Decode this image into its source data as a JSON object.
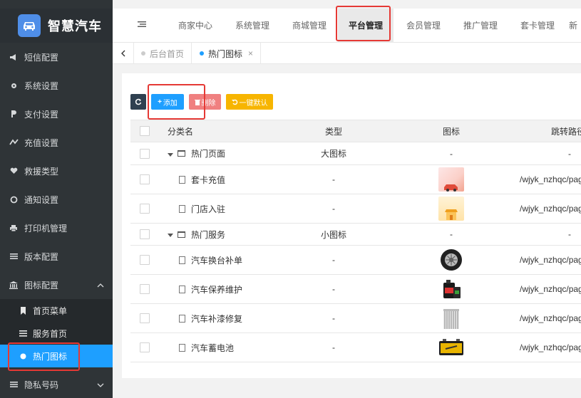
{
  "app": {
    "title": "智慧汽车"
  },
  "sidebar": {
    "items": [
      {
        "label": "短信配置",
        "icon": "megaphone-icon"
      },
      {
        "label": "系统设置",
        "icon": "gear-icon"
      },
      {
        "label": "支付设置",
        "icon": "payment-icon"
      },
      {
        "label": "充值设置",
        "icon": "recharge-icon"
      },
      {
        "label": "救援类型",
        "icon": "heart-icon"
      },
      {
        "label": "通知设置",
        "icon": "circle-icon"
      },
      {
        "label": "打印机管理",
        "icon": "printer-icon"
      },
      {
        "label": "版本配置",
        "icon": "list-icon"
      },
      {
        "label": "图标配置",
        "icon": "bank-icon"
      }
    ],
    "submenu": [
      {
        "label": "首页菜单",
        "icon": "bookmark-icon"
      },
      {
        "label": "服务首页",
        "icon": "list-icon"
      },
      {
        "label": "热门图标",
        "icon": "gear-icon"
      }
    ],
    "last_item": {
      "label": "隐私号码",
      "icon": "list-icon"
    }
  },
  "topnav": {
    "tabs": [
      "商家中心",
      "系统管理",
      "商城管理",
      "平台管理",
      "会员管理",
      "推广管理",
      "套卡管理",
      "新"
    ],
    "active": "平台管理"
  },
  "crumbs": {
    "home": "后台首页",
    "current": "热门图标",
    "close": "×"
  },
  "toolbar": {
    "add": "添加",
    "delete": "删除",
    "default": "一键默认"
  },
  "table": {
    "headers": {
      "name": "分类名",
      "type": "类型",
      "icon": "图标",
      "link": "跳转路径"
    },
    "rows": [
      {
        "kind": "group",
        "name": "热门页面",
        "type": "大图标",
        "icon": "-",
        "link": "-"
      },
      {
        "kind": "item",
        "name": "套卡充值",
        "type": "-",
        "link": "/wjyk_nzhqc/pages/"
      },
      {
        "kind": "item",
        "name": "门店入驻",
        "type": "-",
        "link": "/wjyk_nzhqc/pages/"
      },
      {
        "kind": "group",
        "name": "热门服务",
        "type": "小图标",
        "icon": "-",
        "link": "-"
      },
      {
        "kind": "item",
        "name": "汽车换台补单",
        "type": "-",
        "link": "/wjyk_nzhqc/pages/"
      },
      {
        "kind": "item",
        "name": "汽车保养维护",
        "type": "-",
        "link": "/wjyk_nzhqc/pages/"
      },
      {
        "kind": "item",
        "name": "汽车补漆修复",
        "type": "-",
        "link": "/wjyk_nzhqc/pages/"
      },
      {
        "kind": "item",
        "name": "汽车蓄电池",
        "type": "-",
        "link": "/wjyk_nzhqc/pages/"
      }
    ]
  },
  "colors": {
    "accent": "#1e9fff",
    "sidebar": "#2f3437",
    "highlight": "#e53935"
  }
}
